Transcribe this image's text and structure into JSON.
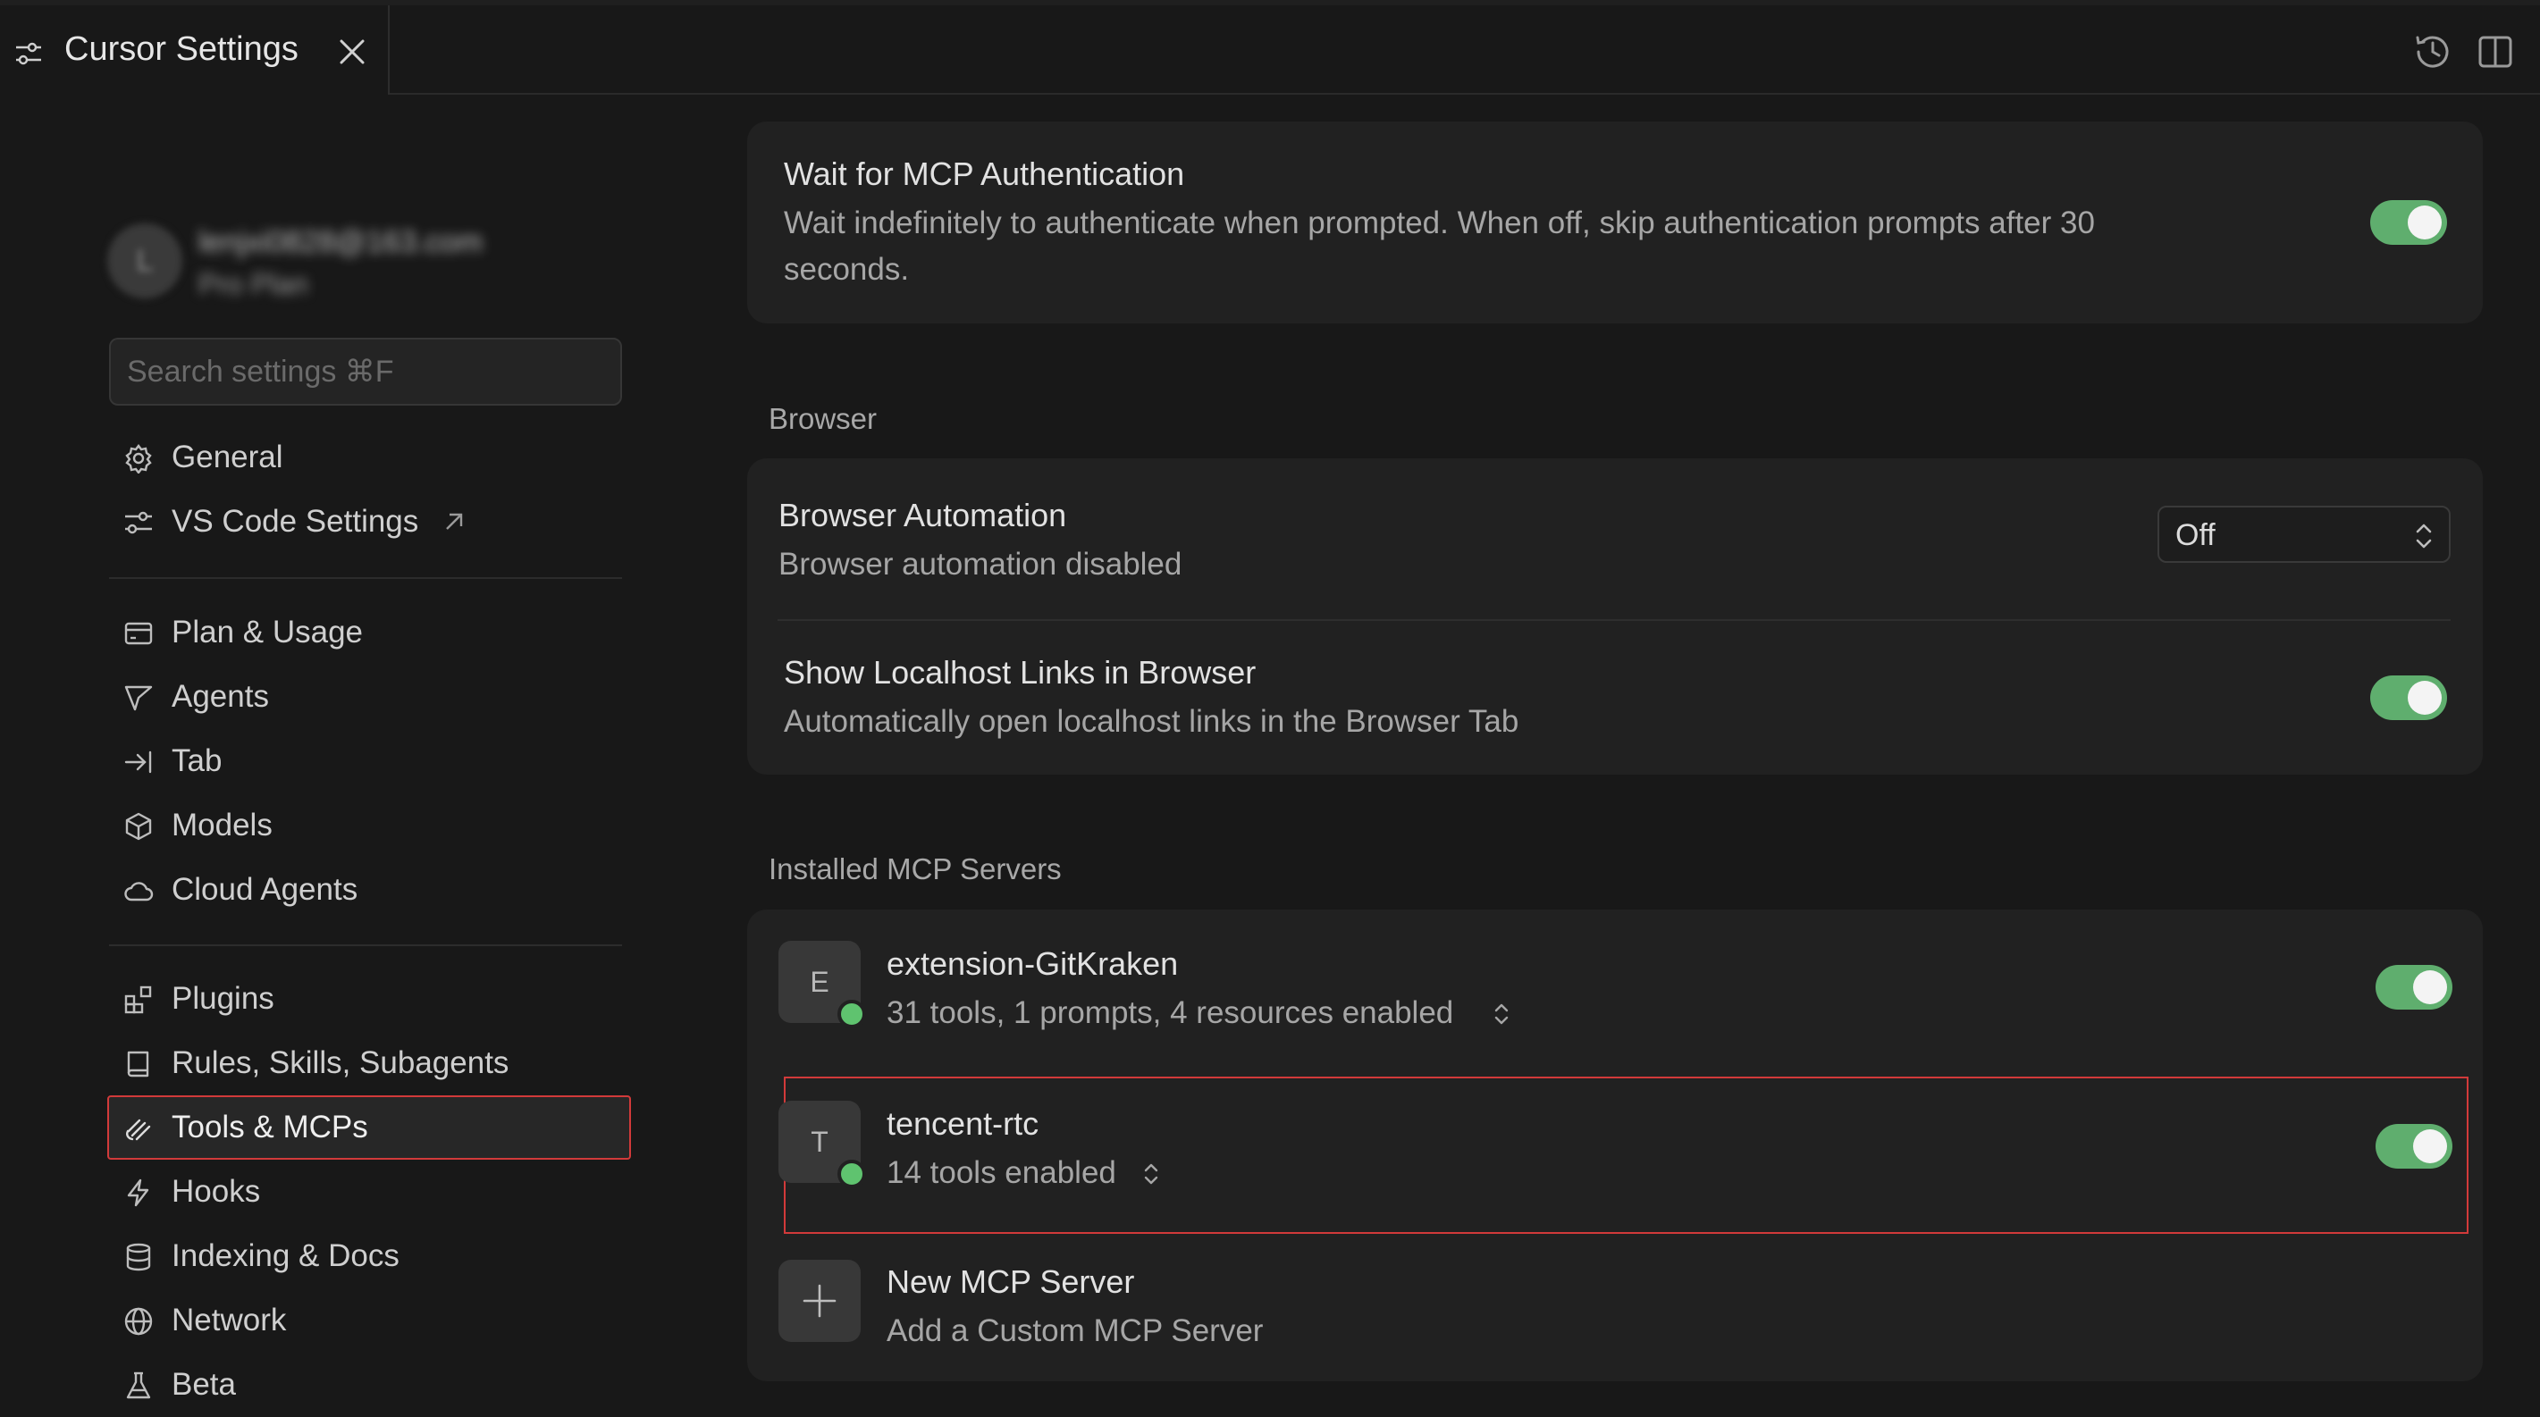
{
  "tab": {
    "title": "Cursor Settings"
  },
  "sidebar": {
    "avatar_letter": "L",
    "email": "lenjxi0828@163.com",
    "plan": "Pro Plan",
    "search_placeholder": "Search settings ⌘F",
    "group1": [
      {
        "label": "General",
        "icon": "gear-icon"
      },
      {
        "label": "VS Code Settings",
        "icon": "sliders-icon",
        "external": "↗"
      }
    ],
    "group2": [
      {
        "label": "Plan & Usage",
        "icon": "card-icon"
      },
      {
        "label": "Agents",
        "icon": "send-icon"
      },
      {
        "label": "Tab",
        "icon": "arrow-bar-icon"
      },
      {
        "label": "Models",
        "icon": "cube-icon"
      },
      {
        "label": "Cloud Agents",
        "icon": "cloud-icon"
      }
    ],
    "group3": [
      {
        "label": "Plugins",
        "icon": "plugin-icon"
      },
      {
        "label": "Rules, Skills, Subagents",
        "icon": "book-icon"
      },
      {
        "label": "Tools & MCPs",
        "icon": "tools-icon",
        "active": true
      },
      {
        "label": "Hooks",
        "icon": "bolt-icon"
      },
      {
        "label": "Indexing & Docs",
        "icon": "database-icon"
      },
      {
        "label": "Network",
        "icon": "globe-icon"
      },
      {
        "label": "Beta",
        "icon": "flask-icon"
      }
    ]
  },
  "main": {
    "wait_mcp": {
      "title": "Wait for MCP Authentication",
      "desc_line1": "Wait indefinitely to authenticate when prompted. When off, skip authentication prompts after 30",
      "desc_line2": "seconds.",
      "enabled": true
    },
    "browser": {
      "section": "Browser",
      "automation_title": "Browser Automation",
      "automation_desc": "Browser automation disabled",
      "automation_value": "Off",
      "localhost_title": "Show Localhost Links in Browser",
      "localhost_desc": "Automatically open localhost links in the Browser Tab",
      "localhost_enabled": true
    },
    "mcp": {
      "section": "Installed MCP Servers",
      "servers": [
        {
          "letter": "E",
          "name": "extension-GitKraken",
          "summary": "31 tools, 1 prompts, 4 resources enabled",
          "enabled": true,
          "status_color": "#5fc36f"
        },
        {
          "letter": "T",
          "name": "tencent-rtc",
          "summary": "14 tools enabled",
          "enabled": true,
          "status_color": "#5fc36f"
        }
      ],
      "new_title": "New MCP Server",
      "new_desc": "Add a Custom MCP Server"
    }
  },
  "colors": {
    "accent_green": "#5fae6e",
    "highlight_red": "#d23a3a",
    "background": "#181818",
    "card": "#212121"
  }
}
